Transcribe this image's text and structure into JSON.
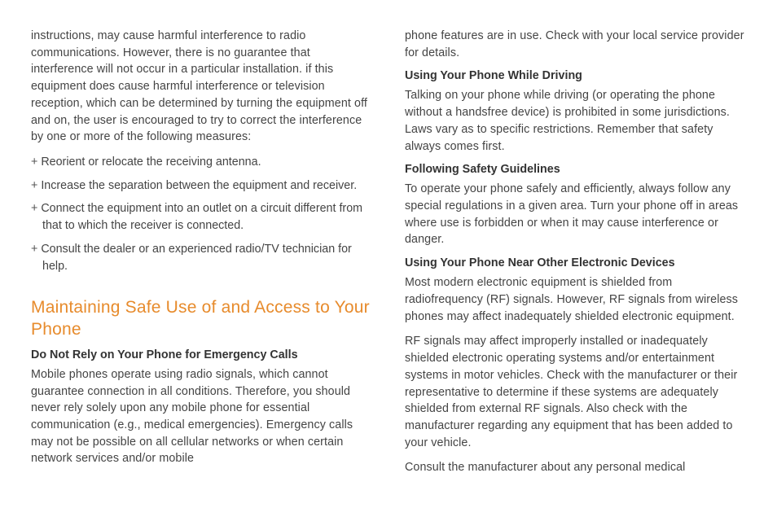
{
  "left": {
    "intro": "instructions, may cause harmful interference to radio communications. However, there is no guarantee that interference will not occur in a particular installation. if this equipment does cause harmful interference or television reception, which can be determined by turning the equipment off and on, the user is encouraged to try to correct the interference by one or more of the following measures:",
    "bullets": [
      "Reorient or relocate the receiving antenna.",
      "Increase the separation between the equipment and receiver.",
      "Connect the equipment into an outlet on a circuit different from that to which the receiver is connected.",
      "Consult the dealer or an experienced radio/TV technician for help."
    ],
    "h2": "Maintaining Safe Use of and Access to Your Phone",
    "h3_emergency": "Do Not Rely on Your Phone for Emergency Calls",
    "emergency_body": "Mobile phones operate using radio signals, which cannot guarantee connection in all conditions. Therefore, you should never rely solely upon any mobile phone for essential communication (e.g., medical emergencies). Emergency calls may not be possible on all cellular networks or when certain network services and/or mobile"
  },
  "right": {
    "cont": "phone features are in use. Check with your local service provider for details.",
    "h3_driving": "Using Your Phone While Driving",
    "driving_body": "Talking on your phone while driving (or operating the phone without a handsfree device) is prohibited in some jurisdictions. Laws vary as to specific restrictions. Remember that safety always comes first.",
    "h3_safety": "Following Safety Guidelines",
    "safety_body": "To operate your phone safely and efficiently, always follow any special regulations in a given area. Turn your phone off in areas where use is forbidden or when it may cause interference or danger.",
    "h3_elec": "Using Your Phone Near Other Electronic Devices",
    "elec_body1": "Most modern electronic equipment is shielded from radiofrequency (RF) signals. However, RF signals from wireless phones may affect inadequately shielded electronic equipment.",
    "elec_body2": "RF signals may affect improperly installed or inadequately shielded electronic operating systems and/or entertainment systems in motor vehicles. Check with the manufacturer or their representative to determine if these systems are adequately shielded from external RF signals. Also check with the manufacturer regarding any equipment that has been added to your vehicle.",
    "elec_body3": "Consult the manufacturer about any personal medical"
  }
}
